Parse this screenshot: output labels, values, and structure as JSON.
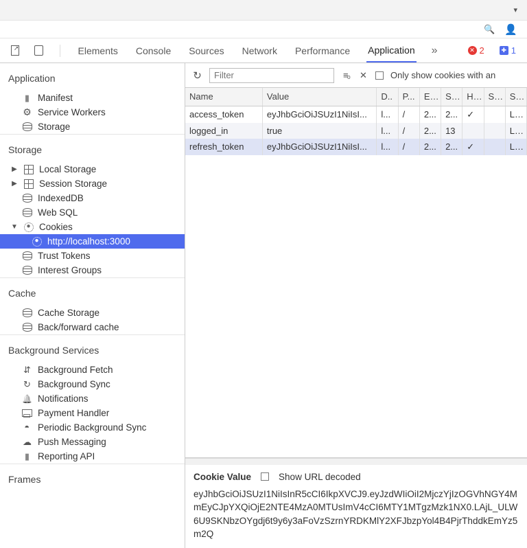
{
  "tabs": [
    "Elements",
    "Console",
    "Sources",
    "Network",
    "Performance",
    "Application"
  ],
  "tabs_active_index": 5,
  "errors_count": "2",
  "messages_count": "1",
  "sidebar": {
    "application": {
      "title": "Application",
      "items": [
        "Manifest",
        "Service Workers",
        "Storage"
      ]
    },
    "storage": {
      "title": "Storage",
      "local": "Local Storage",
      "session": "Session Storage",
      "indexeddb": "IndexedDB",
      "websql": "Web SQL",
      "cookies": "Cookies",
      "cookies_child": "http://localhost:3000",
      "trust": "Trust Tokens",
      "interest": "Interest Groups"
    },
    "cache": {
      "title": "Cache",
      "items": [
        "Cache Storage",
        "Back/forward cache"
      ]
    },
    "bg": {
      "title": "Background Services",
      "items": [
        "Background Fetch",
        "Background Sync",
        "Notifications",
        "Payment Handler",
        "Periodic Background Sync",
        "Push Messaging",
        "Reporting API"
      ]
    },
    "frames": {
      "title": "Frames"
    }
  },
  "filter": {
    "placeholder": "Filter",
    "only_httponly": "Only show cookies with an"
  },
  "table": {
    "headers": [
      "Name",
      "Value",
      "D..",
      "P...",
      "E...",
      "S...",
      "H...",
      "S...",
      "S..."
    ],
    "rows": [
      {
        "name": "access_token",
        "value": "eyJhbGciOiJSUzI1NiIsI...",
        "d": "l...",
        "p": "/",
        "e": "2...",
        "s": "2...",
        "h": "✓",
        "s2": "",
        "s3": "Lax"
      },
      {
        "name": "logged_in",
        "value": "true",
        "d": "l...",
        "p": "/",
        "e": "2...",
        "s": "13",
        "h": "",
        "s2": "",
        "s3": "Lax"
      },
      {
        "name": "refresh_token",
        "value": "eyJhbGciOiJSUzI1NiIsI...",
        "d": "l...",
        "p": "/",
        "e": "2...",
        "s": "2...",
        "h": "✓",
        "s2": "",
        "s3": "Lax"
      }
    ],
    "selected_index": 2
  },
  "detail": {
    "label": "Cookie Value",
    "decoded_label": "Show URL decoded",
    "value": "eyJhbGciOiJSUzI1NiIsInR5cCI6IkpXVCJ9.eyJzdWIiOiI2MjczYjIzOGVhNGY4MmEyCJpYXQiOjE2NTE4MzA0MTUsImV4cCI6MTY1MTgzMzk1NX0.LAjL_ULW6U9SKNbzOYgdj6t9y6y3aFoVzSzrnYRDKMlY2XFJbzpYol4B4PjrThddkEmYz5m2Q"
  }
}
